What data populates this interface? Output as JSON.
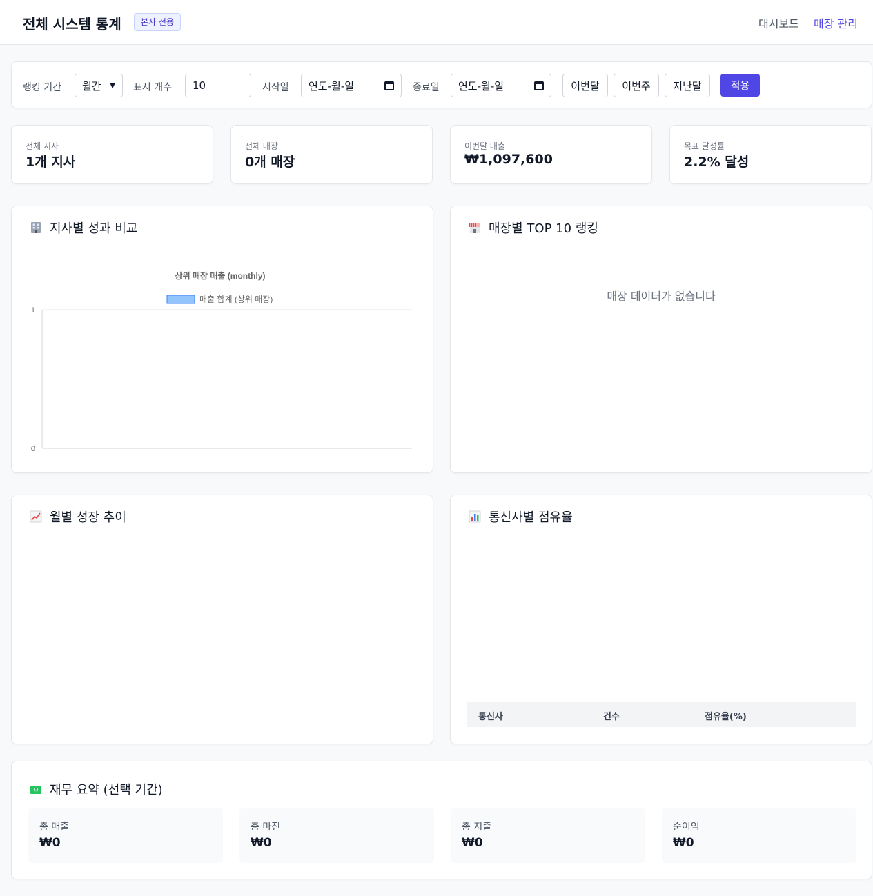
{
  "header": {
    "title": "전체 시스템 통계",
    "badge": "본사 전용",
    "nav": {
      "dashboard": "대시보드",
      "store_management": "매장 관리"
    }
  },
  "filters": {
    "ranking_period_label": "랭킹 기간",
    "ranking_period_value": "월간",
    "display_count_label": "표시 개수",
    "display_count_value": "10",
    "start_date_label": "시작일",
    "start_date_placeholder": "연도-월-일",
    "end_date_label": "종료일",
    "end_date_placeholder": "연도-월-일",
    "buttons": {
      "this_month": "이번달",
      "this_week": "이번주",
      "last_month": "지난달",
      "apply": "적용"
    }
  },
  "stats": [
    {
      "label": "전체 지사",
      "value": "1개 지사"
    },
    {
      "label": "전체 매장",
      "value": "0개 매장"
    },
    {
      "label": "이번달 매출",
      "value": "₩1,097,600"
    },
    {
      "label": "목표 달성률",
      "value": "2.2% 달성"
    }
  ],
  "panels": {
    "branch_comparison": {
      "icon": "office-building-icon",
      "title": "지사별 성과 비교"
    },
    "store_ranking": {
      "icon": "store-icon",
      "title": "매장별 TOP 10 랭킹",
      "empty_message": "매장 데이터가 없습니다"
    },
    "monthly_growth": {
      "icon": "chart-increasing-icon",
      "title": "월별 성장 추이"
    },
    "carrier_share": {
      "icon": "bar-chart-icon",
      "title": "통신사별 점유율",
      "table_headers": [
        "통신사",
        "건수",
        "점유율(%)"
      ]
    },
    "finance": {
      "icon": "money-icon",
      "title": "재무 요약 (선택 기간)",
      "items": [
        {
          "label": "총 매출",
          "value": "₩0"
        },
        {
          "label": "총 마진",
          "value": "₩0"
        },
        {
          "label": "총 지출",
          "value": "₩0"
        },
        {
          "label": "순이익",
          "value": "₩0"
        }
      ]
    }
  },
  "colors": {
    "accent": "#4f46e5",
    "bar_fill": "#93c5fd",
    "bar_stroke": "#3b82f6"
  },
  "chart_data": {
    "type": "bar",
    "title": "상위 매장 매출 (monthly)",
    "categories": [],
    "series": [
      {
        "name": "매출 합계 (상위 매장)",
        "values": []
      }
    ],
    "y_ticks": [
      "1",
      "0"
    ],
    "ylim": [
      0,
      1
    ],
    "legend": "top"
  }
}
